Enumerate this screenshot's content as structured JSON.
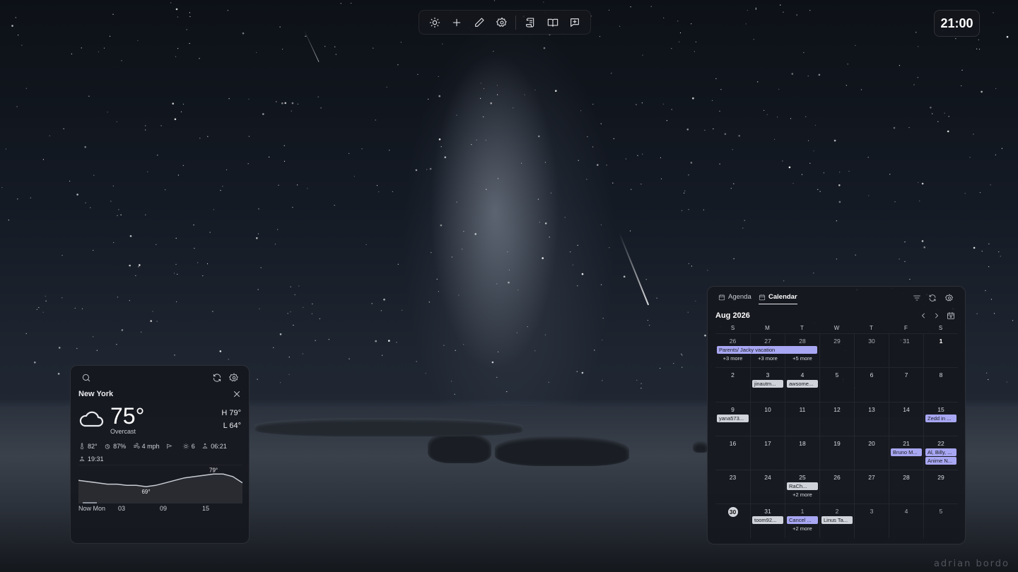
{
  "toolbar": {
    "icons": [
      "sun-icon",
      "plus-icon",
      "pencil-icon",
      "gear-icon",
      "scroll-icon",
      "book-icon",
      "message-plus-icon"
    ]
  },
  "clock": {
    "time": "21:00"
  },
  "watermark": "adrian bordo",
  "weather": {
    "city": "New York",
    "temp": "75°",
    "condition": "Overcast",
    "high": "H 79°",
    "low": "L 64°",
    "stats": {
      "feels_like": "82°",
      "humidity": "87%",
      "wind": "4 mph",
      "uv": "6",
      "sunrise": "06:21",
      "sunset": "19:31"
    },
    "chart": {
      "max_label": "79°",
      "min_label": "69°",
      "axis": [
        "Now Mon",
        "03",
        "09",
        "15"
      ],
      "temps": [
        74,
        73,
        72,
        71,
        71,
        70,
        70,
        69,
        70,
        72,
        74,
        76,
        77,
        78,
        79,
        79,
        77,
        72
      ]
    }
  },
  "calendar": {
    "tabs": {
      "agenda": "Agenda",
      "calendar": "Calendar"
    },
    "month_label": "Aug 2026",
    "dow": [
      "S",
      "M",
      "T",
      "W",
      "T",
      "F",
      "S"
    ],
    "span_event": "Parents/ Jacky vacation",
    "weeks": [
      [
        {
          "d": "26",
          "dim": true,
          "more": "+3 more"
        },
        {
          "d": "27",
          "dim": true,
          "more": "+3 more"
        },
        {
          "d": "28",
          "dim": true,
          "more": "+5 more"
        },
        {
          "d": "29",
          "dim": true
        },
        {
          "d": "30",
          "dim": true
        },
        {
          "d": "31",
          "dim": true
        },
        {
          "d": "1",
          "bold": true
        }
      ],
      [
        {
          "d": "2"
        },
        {
          "d": "3",
          "chips": [
            {
              "t": "jinautm...",
              "c": "gray"
            }
          ]
        },
        {
          "d": "4",
          "chips": [
            {
              "t": "awsome...",
              "c": "gray"
            }
          ]
        },
        {
          "d": "5"
        },
        {
          "d": "6"
        },
        {
          "d": "7"
        },
        {
          "d": "8"
        }
      ],
      [
        {
          "d": "9",
          "chips": [
            {
              "t": "yana573...",
              "c": "gray"
            }
          ]
        },
        {
          "d": "10"
        },
        {
          "d": "11"
        },
        {
          "d": "12"
        },
        {
          "d": "13"
        },
        {
          "d": "14"
        },
        {
          "d": "15",
          "chips": [
            {
              "t": "Zedd in ...",
              "c": "purple"
            }
          ]
        }
      ],
      [
        {
          "d": "16"
        },
        {
          "d": "17"
        },
        {
          "d": "18"
        },
        {
          "d": "19"
        },
        {
          "d": "20"
        },
        {
          "d": "21",
          "chips": [
            {
              "t": "Bruno M...",
              "c": "purple"
            }
          ]
        },
        {
          "d": "22",
          "chips": [
            {
              "t": "Al, Billy, ...",
              "c": "purple"
            },
            {
              "t": "Anime N...",
              "c": "purple"
            }
          ]
        }
      ],
      [
        {
          "d": "23"
        },
        {
          "d": "24"
        },
        {
          "d": "25",
          "chips": [
            {
              "t": "RaCh...",
              "c": "gray"
            }
          ],
          "more": "+2 more"
        },
        {
          "d": "26"
        },
        {
          "d": "27"
        },
        {
          "d": "28"
        },
        {
          "d": "29"
        }
      ],
      [
        {
          "d": "30",
          "today": true
        },
        {
          "d": "31",
          "chips": [
            {
              "t": "toom92...",
              "c": "gray"
            }
          ]
        },
        {
          "d": "1",
          "dim": true,
          "chips": [
            {
              "t": "Cancel ...",
              "c": "purple"
            }
          ],
          "more": "+2 more"
        },
        {
          "d": "2",
          "dim": true,
          "chips": [
            {
              "t": "Linus Ta...",
              "c": "gray"
            }
          ]
        },
        {
          "d": "3",
          "dim": true
        },
        {
          "d": "4",
          "dim": true
        },
        {
          "d": "5",
          "dim": true
        }
      ]
    ]
  }
}
